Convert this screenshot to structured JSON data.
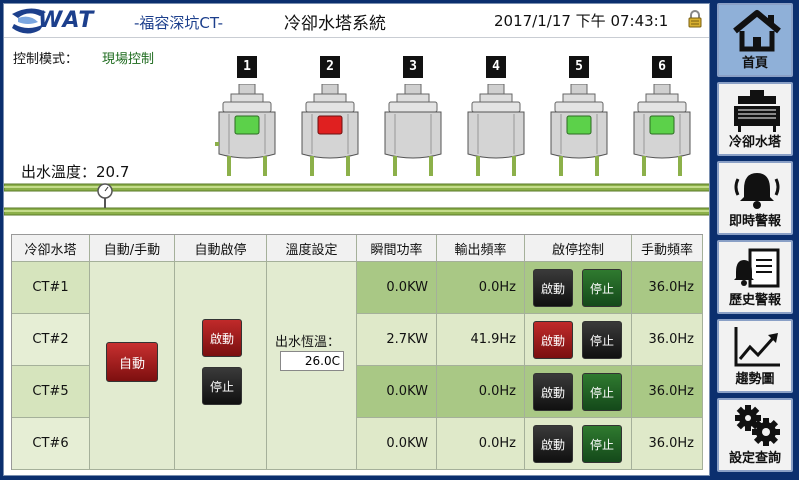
{
  "header": {
    "brand": "WAT",
    "brand_sub": "-福容深坑CT-",
    "title": "冷卻水塔系統",
    "datetime": "2017/1/17  下午  07:43:1"
  },
  "mode": {
    "label": "控制模式：",
    "value": "現場控制"
  },
  "water_temp": {
    "label": "出水溫度：",
    "value": "20.7"
  },
  "towers": [
    {
      "num": "1",
      "status": "green"
    },
    {
      "num": "2",
      "status": "red"
    },
    {
      "num": "3",
      "status": "off"
    },
    {
      "num": "4",
      "status": "off"
    },
    {
      "num": "5",
      "status": "green"
    },
    {
      "num": "6",
      "status": "green"
    }
  ],
  "table": {
    "headers": [
      "冷卻水塔",
      "自動/手動",
      "自動啟停",
      "溫度設定",
      "瞬間功率",
      "輸出頻率",
      "啟停控制",
      "手動頻率"
    ],
    "rows": [
      {
        "name": "CT#1",
        "power": "0.0KW",
        "freq": "0.0Hz",
        "manual": "36.0Hz",
        "running": false
      },
      {
        "name": "CT#2",
        "power": "2.7KW",
        "freq": "41.9Hz",
        "manual": "36.0Hz",
        "running": true
      },
      {
        "name": "CT#5",
        "power": "0.0KW",
        "freq": "0.0Hz",
        "manual": "36.0Hz",
        "running": false
      },
      {
        "name": "CT#6",
        "power": "0.0KW",
        "freq": "0.0Hz",
        "manual": "36.0Hz",
        "running": false
      }
    ],
    "auto_label": "自動",
    "start_label": "啟動",
    "stop_label": "停止",
    "temp_label": "出水恆溫：",
    "temp_value": "26.0C"
  },
  "nav": [
    {
      "label": "首頁",
      "icon": "home-icon"
    },
    {
      "label": "冷卻水塔",
      "icon": "cooling-tower-icon"
    },
    {
      "label": "即時警報",
      "icon": "bell-icon"
    },
    {
      "label": "歷史警報",
      "icon": "alarm-history-icon"
    },
    {
      "label": "趨勢圖",
      "icon": "trend-chart-icon"
    },
    {
      "label": "設定查詢",
      "icon": "gear-icon"
    }
  ],
  "colors": {
    "frame": "#0b2f6e",
    "pipe": "#8cb04a",
    "light_green": "#5cd14a",
    "light_red": "#e02020",
    "header_dark": "#a9c885",
    "row_light": "#dfe9c9"
  }
}
